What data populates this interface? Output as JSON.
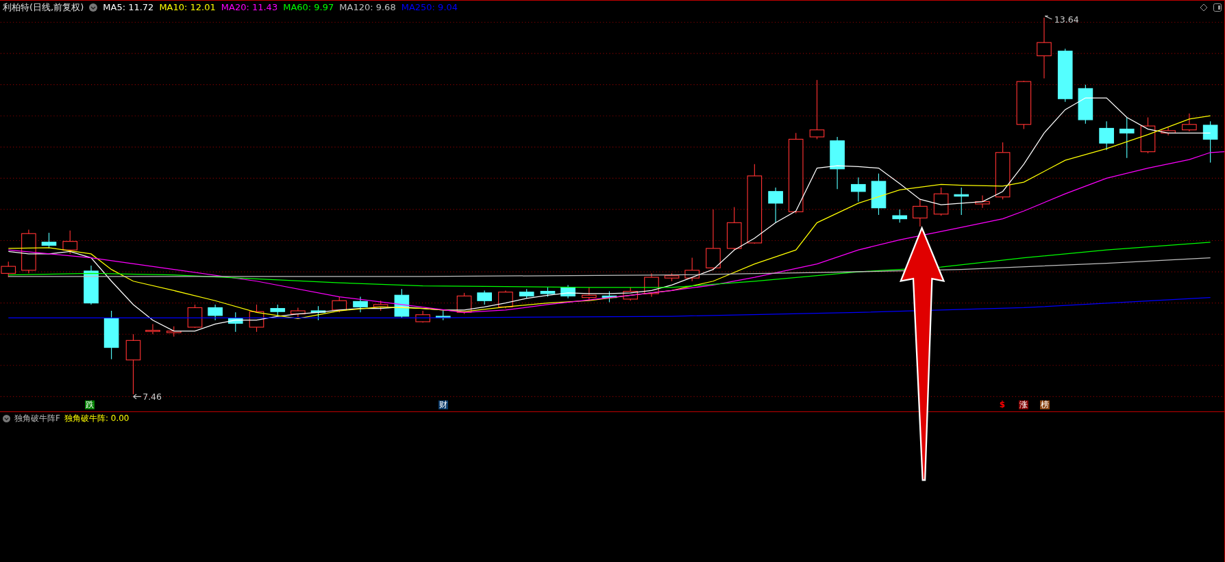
{
  "header": {
    "title": "利柏特(日线,前复权)",
    "ma_readings": [
      {
        "label": "MA5: 11.72",
        "color": "#ffffff"
      },
      {
        "label": "MA10: 12.01",
        "color": "#ffff00"
      },
      {
        "label": "MA20: 11.43",
        "color": "#ff00ff"
      },
      {
        "label": "MA60: 9.97",
        "color": "#00ff00"
      },
      {
        "label": "MA120: 9.68",
        "color": "#c0c0c0"
      },
      {
        "label": "MA250: 9.04",
        "color": "#0000ff"
      }
    ]
  },
  "price_chart": {
    "high_label": "13.64",
    "low_label": "7.46",
    "event_markers": [
      {
        "text": "跌",
        "kind": "badge",
        "color": "#008000"
      },
      {
        "text": "财",
        "kind": "badge",
        "color": "#0a3a6a"
      },
      {
        "text": "$",
        "kind": "glyph",
        "color": "#ff0000"
      },
      {
        "text": "涨",
        "kind": "badge",
        "color": "#800000"
      },
      {
        "text": "榜",
        "kind": "badge",
        "color": "#8b4513"
      }
    ]
  },
  "indicator_panel": {
    "name": "独角破牛阵F",
    "reading": "独角破牛阵: 0.00"
  }
}
